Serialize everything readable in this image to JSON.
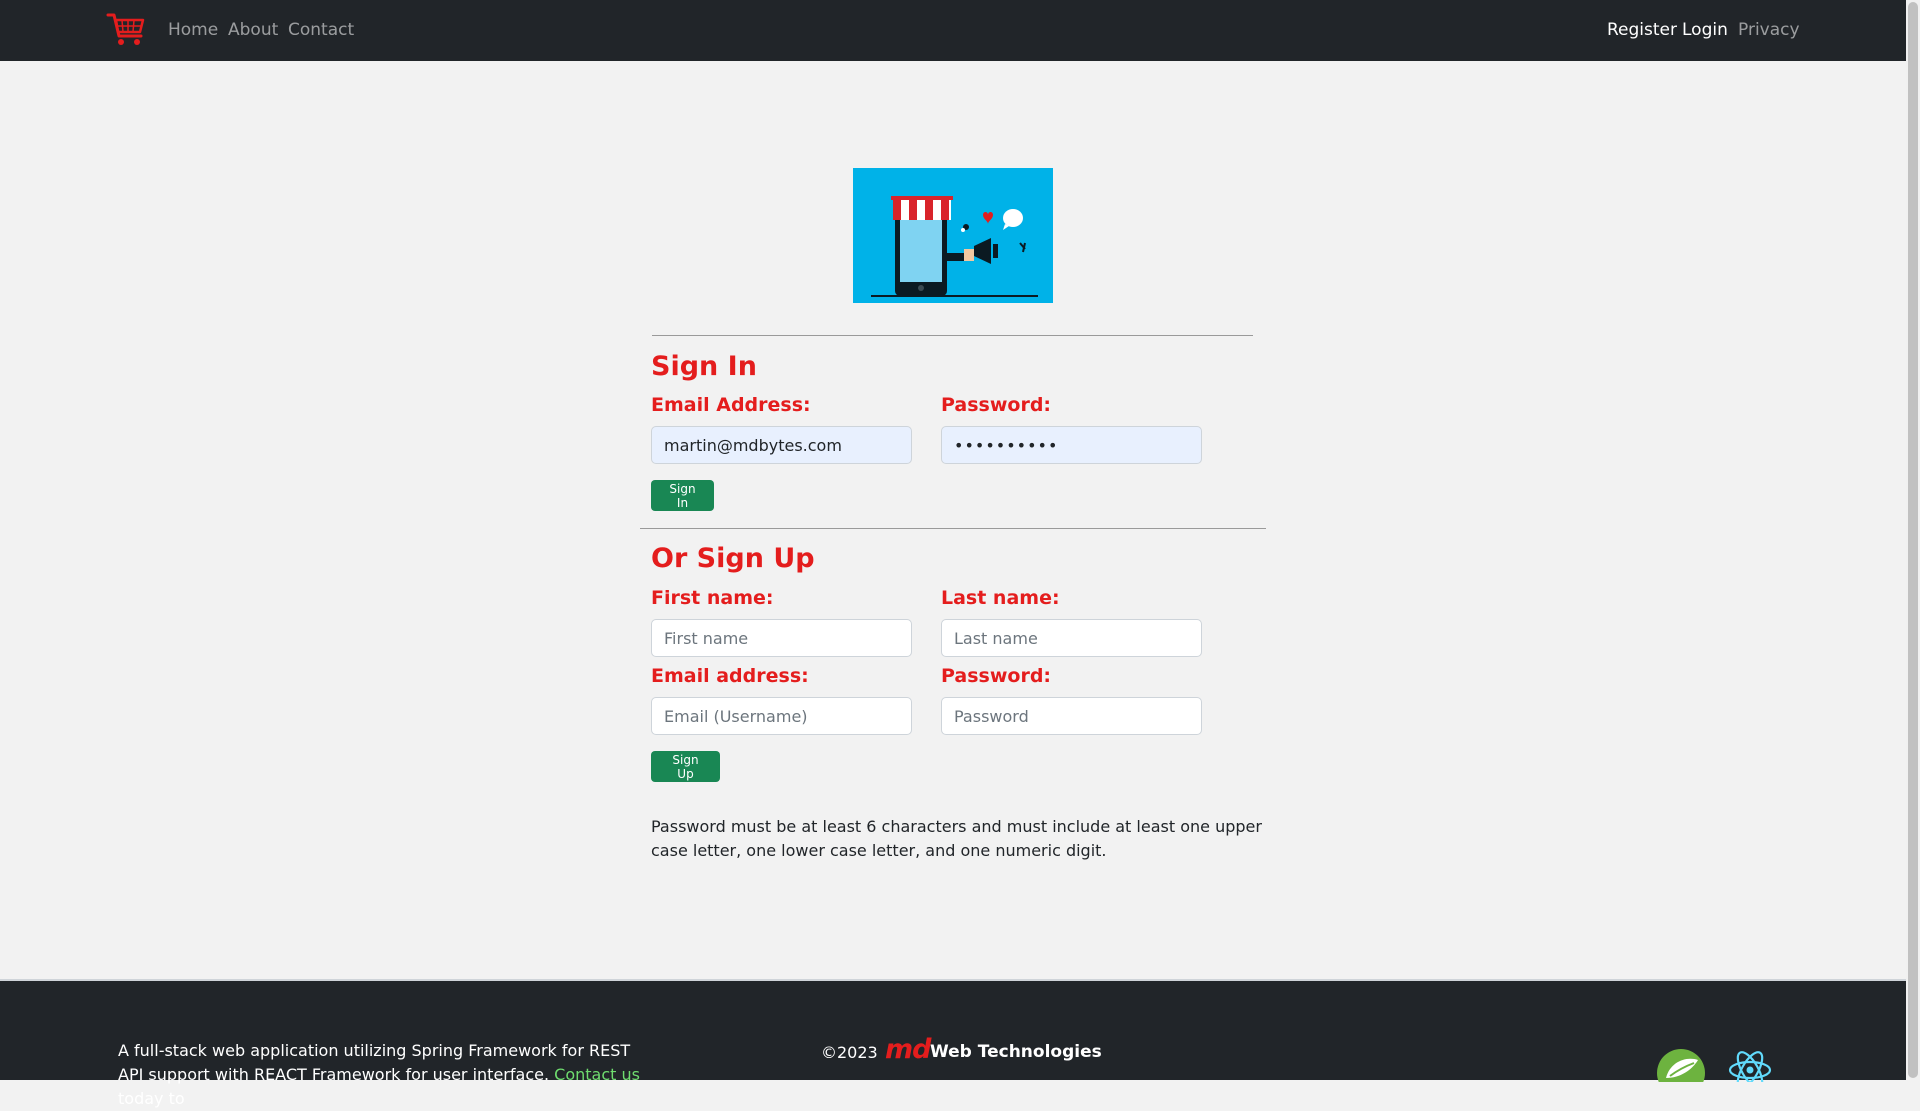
{
  "nav": {
    "brand_icon": "shopping-cart-icon",
    "left_links": [
      "Home",
      "About",
      "Contact"
    ],
    "right_links": [
      "Register",
      "Login",
      "Privacy"
    ]
  },
  "hero": {
    "image": "online-store-phone-illustration"
  },
  "sign_in": {
    "title": "Sign In",
    "email_label": "Email Address:",
    "email_value": "martin@mdbytes.com",
    "password_label": "Password:",
    "password_value": "••••••••••",
    "button": "Sign In"
  },
  "sign_up": {
    "title": "Or Sign Up",
    "first_label": "First name:",
    "first_placeholder": "First name",
    "last_label": "Last name:",
    "last_placeholder": "Last name",
    "email_label": "Email address:",
    "email_placeholder": "Email (Username)",
    "password_label": "Password:",
    "password_placeholder": "Password",
    "button": "Sign Up",
    "note": "Password must be at least 6 characters and must include at least one upper case letter, one lower case letter, and one numeric digit."
  },
  "footer": {
    "description_before": "A full-stack web application utilizing Spring Framework for REST API support with REACT Framework for user interface.",
    "contact_link": "Contact us",
    "description_after": "today to",
    "copyright": "©2023",
    "logo_text": "md",
    "company": "Web Technologies",
    "icons": [
      "spring-leaf-icon",
      "react-atom-icon"
    ]
  },
  "colors": {
    "navbar_bg": "#212529",
    "accent_red": "#e41d1d",
    "button_green": "#198754",
    "hero_blue": "#00b2e8",
    "page_bg": "#f2f2f2",
    "link_green": "#6fdc6f"
  }
}
